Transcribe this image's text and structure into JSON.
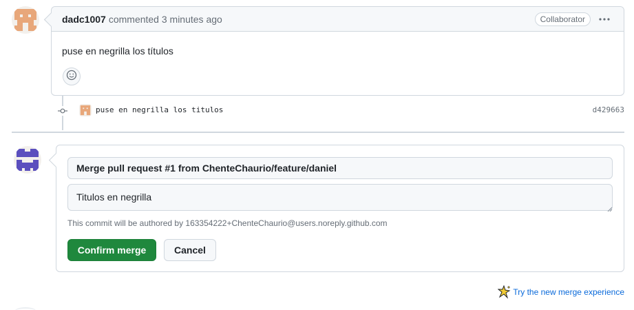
{
  "comment": {
    "author": "dadc1007",
    "meta": "commented 3 minutes ago",
    "role_badge": "Collaborator",
    "body": "puse en negrilla los títulos",
    "menu_icon": "kebab-horizontal-icon",
    "reaction_icon": "smiley-icon"
  },
  "commit": {
    "message": "puse en negrilla los titulos",
    "sha": "d429663",
    "node_icon": "git-commit-icon"
  },
  "merge": {
    "title_value": "Merge pull request #1 from ChenteChaurio/feature/daniel",
    "description_value": "Titulos en negrilla",
    "author_note": "This commit will be authored by 163354222+ChenteChaurio@users.noreply.github.com",
    "confirm_label": "Confirm merge",
    "cancel_label": "Cancel"
  },
  "footer": {
    "try_link": "Try the new merge experience",
    "try_icon": "sparkle-icon"
  },
  "colors": {
    "accent_green": "#1f883d",
    "link_blue": "#0969da",
    "border": "#d0d7de",
    "avatar_orange": "#e8a77a",
    "avatar_purple": "#5b4fbe"
  }
}
